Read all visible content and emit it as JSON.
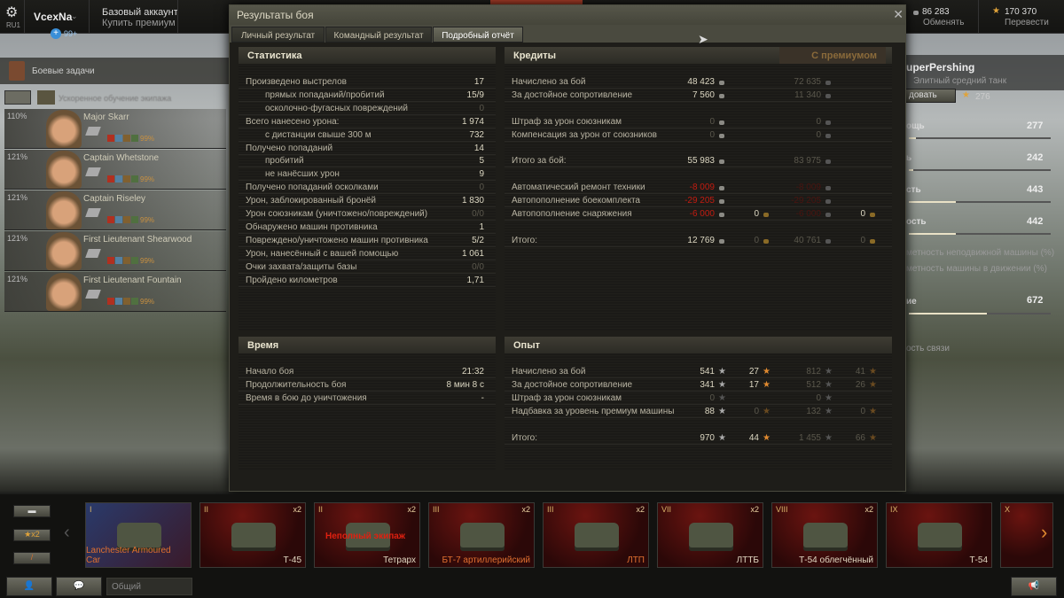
{
  "topbar": {
    "server": "RU1",
    "username": "VcexNa",
    "badge": "99+",
    "account_type": "Базовый аккаунт",
    "buy_premium": "Купить премиум",
    "credits": "86 283",
    "exchange": "Обменять",
    "gold": "170 370",
    "transfer": "Перевести"
  },
  "left": {
    "missions": "Боевые задачи",
    "training": "Ускоренное обучение экипажа",
    "crew": [
      {
        "name": "Major Skarr",
        "pct": "110%",
        "skill": "99%"
      },
      {
        "name": "Captain Whetstone",
        "pct": "121%",
        "skill": "99%"
      },
      {
        "name": "Captain Riseley",
        "pct": "121%",
        "skill": "99%"
      },
      {
        "name": "First Lieutenant Shearwood",
        "pct": "121%",
        "skill": "99%"
      },
      {
        "name": "First Lieutenant Fountain",
        "pct": "121%",
        "skill": "99%"
      }
    ]
  },
  "right": {
    "tank_name": "uperPershing",
    "tank_type": "Элитный средний танк",
    "research": "довать",
    "xp": "276",
    "stats": [
      {
        "label": "ощь",
        "value": "277",
        "fill": 0.05
      },
      {
        "label": "ь",
        "value": "242",
        "fill": 0.03
      },
      {
        "label": "сть",
        "value": "443",
        "fill": 0.33
      },
      {
        "label": "ость",
        "value": "442",
        "fill": 0.33
      }
    ],
    "camo1": "метность неподвижной машины (%)",
    "camo2": "метность машины в движении (%)",
    "view_label": "ие",
    "view_value": "672",
    "view_fill": 0.55,
    "radio": "ость связи"
  },
  "dialog": {
    "title": "Результаты боя",
    "tabs": [
      "Личный результат",
      "Командный результат",
      "Подробный отчёт"
    ],
    "active_tab": 2
  },
  "stats": {
    "title": "Статистика",
    "rows": [
      {
        "label": "Произведено выстрелов",
        "value": "17"
      },
      {
        "label": "прямых попаданий/пробитий",
        "value": "15/9",
        "indent": true
      },
      {
        "label": "осколочно-фугасных повреждений",
        "value": "0",
        "indent": true,
        "dim": true
      },
      {
        "label": "Всего нанесено урона:",
        "value": "1 974"
      },
      {
        "label": "с дистанции свыше 300 м",
        "value": "732",
        "indent": true
      },
      {
        "label": "Получено попаданий",
        "value": "14"
      },
      {
        "label": "пробитий",
        "value": "5",
        "indent": true
      },
      {
        "label": "не нанёсших урон",
        "value": "9",
        "indent": true
      },
      {
        "label": "Получено попаданий осколками",
        "value": "0",
        "dim": true
      },
      {
        "label": "Урон, заблокированный бронёй",
        "value": "1 830"
      },
      {
        "label": "Урон союзникам (уничтожено/повреждений)",
        "value": "0/0",
        "dim": true
      },
      {
        "label": "Обнаружено машин противника",
        "value": "1"
      },
      {
        "label": "Повреждено/уничтожено машин противника",
        "value": "5/2"
      },
      {
        "label": "Урон, нанесённый с вашей помощью",
        "value": "1 061"
      },
      {
        "label": "Очки захвата/защиты базы",
        "value": "0/0",
        "dim": true
      },
      {
        "label": "Пройдено километров",
        "value": "1,71"
      }
    ]
  },
  "time": {
    "title": "Время",
    "rows": [
      {
        "label": "Начало боя",
        "value": "21:32"
      },
      {
        "label": "Продолжительность боя",
        "value": "8 мин 8 с"
      },
      {
        "label": "Время в бою до уничтожения",
        "value": "-"
      }
    ]
  },
  "credits": {
    "title": "Кредиты",
    "premium_header": "С премиумом",
    "rows": [
      {
        "label": "Начислено за бой",
        "v": [
          "48 423",
          "",
          "72 635",
          ""
        ],
        "dim": [
          false,
          false,
          true,
          false
        ]
      },
      {
        "label": "За достойное сопротивление",
        "v": [
          "7 560",
          "",
          "11 340",
          ""
        ],
        "dim": [
          false,
          false,
          true,
          false
        ]
      },
      null,
      {
        "label": "Штраф за урон союзникам",
        "v": [
          "0",
          "",
          "0",
          ""
        ],
        "dim": [
          true,
          false,
          true,
          false
        ]
      },
      {
        "label": "Компенсация за урон от союзников",
        "v": [
          "0",
          "",
          "0",
          ""
        ],
        "dim": [
          true,
          false,
          true,
          false
        ]
      },
      null,
      {
        "label": "Итого за бой:",
        "v": [
          "55 983",
          "",
          "83 975",
          ""
        ],
        "dim": [
          false,
          false,
          true,
          false
        ]
      },
      null,
      {
        "label": "Автоматический ремонт техники",
        "v": [
          "-8 009",
          "",
          "-8 009",
          ""
        ],
        "red": true
      },
      {
        "label": "Автопополнение боекомплекта",
        "v": [
          "-29 205",
          "",
          "-29 205",
          ""
        ],
        "red": true
      },
      {
        "label": "Автопополнение снаряжения",
        "v": [
          "-6 000",
          "0",
          "-6 000",
          "0"
        ],
        "red": true
      },
      null,
      {
        "label": "Итого:",
        "v": [
          "12 769",
          "0",
          "40 761",
          "0"
        ],
        "dim": [
          false,
          true,
          true,
          true
        ]
      }
    ]
  },
  "experience": {
    "title": "Опыт",
    "rows": [
      {
        "label": "Начислено за бой",
        "v": [
          "541",
          "27",
          "812",
          "41"
        ],
        "dim": [
          false,
          false,
          true,
          true
        ]
      },
      {
        "label": "За достойное сопротивление",
        "v": [
          "341",
          "17",
          "512",
          "26"
        ],
        "dim": [
          false,
          false,
          true,
          true
        ]
      },
      {
        "label": "Штраф за урон союзникам",
        "v": [
          "0",
          "",
          "0",
          ""
        ],
        "dim": [
          true,
          false,
          true,
          false
        ]
      },
      {
        "label": "Надбавка за уровень премиум машины",
        "v": [
          "88",
          "0",
          "132",
          "0"
        ],
        "dim": [
          false,
          true,
          true,
          true
        ]
      },
      null,
      {
        "label": "Итого:",
        "v": [
          "970",
          "44",
          "1 455",
          "66"
        ],
        "dim": [
          false,
          false,
          true,
          true
        ]
      }
    ]
  },
  "carousel": {
    "filter_x2": "x2",
    "tanks": [
      {
        "tier": "I",
        "name": "Lanchester Armoured Car",
        "x2": "",
        "flag": "uk"
      },
      {
        "tier": "II",
        "name": "Т-45",
        "x2": "x2"
      },
      {
        "tier": "II",
        "name": "Тетрарх",
        "x2": "x2",
        "warning": "Неполный экипаж"
      },
      {
        "tier": "III",
        "name": "БТ-7 артиллерийский",
        "x2": "x2"
      },
      {
        "tier": "III",
        "name": "ЛТП",
        "x2": "x2"
      },
      {
        "tier": "VII",
        "name": "ЛТТБ",
        "x2": "x2"
      },
      {
        "tier": "VIII",
        "name": "Т-54 облегчённый",
        "x2": "x2"
      },
      {
        "tier": "IX",
        "name": "Т-54",
        "x2": ""
      },
      {
        "tier": "X",
        "name": "",
        "x2": ""
      }
    ]
  },
  "chat": {
    "channel": "Общий"
  },
  "colors": {
    "accent": "#e0a33a",
    "negative": "#c21b10"
  }
}
